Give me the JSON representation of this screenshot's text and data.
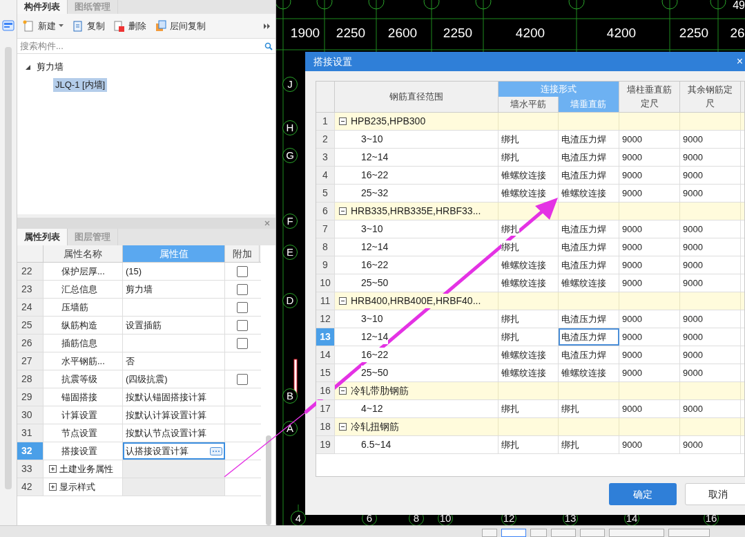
{
  "component_panel": {
    "tabs": [
      {
        "label": "构件列表",
        "selected": true
      },
      {
        "label": "图纸管理",
        "selected": false
      }
    ],
    "toolbar": [
      {
        "label": "新建",
        "dropdown": true
      },
      {
        "label": "复制",
        "dropdown": false
      },
      {
        "label": "删除",
        "dropdown": false
      },
      {
        "label": "层间复制",
        "dropdown": false
      }
    ],
    "search": {
      "placeholder": "搜索构件..."
    },
    "tree": [
      {
        "label": "剪力墙",
        "expanded": true,
        "selected": false,
        "children": [
          {
            "label": "JLQ-1 [内墙]",
            "selected": true
          }
        ]
      }
    ]
  },
  "property_panel": {
    "tabs": [
      {
        "label": "属性列表",
        "selected": true
      },
      {
        "label": "图层管理",
        "selected": false
      }
    ],
    "columns": [
      {
        "label": "属性名称",
        "selected": false
      },
      {
        "label": "属性值",
        "selected": true
      },
      {
        "label": "附加",
        "selected": false
      }
    ],
    "rows": [
      {
        "index": "22",
        "kind": "check",
        "name": "保护层厚...",
        "value": "(15)",
        "checked": false,
        "selected": false
      },
      {
        "index": "23",
        "kind": "check",
        "name": "汇总信息",
        "value": "剪力墙",
        "checked": false,
        "selected": false
      },
      {
        "index": "24",
        "kind": "check",
        "name": "压墙筋",
        "checked": false,
        "selected": false
      },
      {
        "index": "25",
        "kind": "check",
        "name": "纵筋构造",
        "value": "设置插筋",
        "checked": false,
        "selected": false
      },
      {
        "index": "26",
        "kind": "check",
        "name": "插筋信息",
        "checked": false,
        "selected": false
      },
      {
        "index": "27",
        "kind": "text",
        "name": "水平钢筋...",
        "value": "否",
        "selected": false
      },
      {
        "index": "28",
        "kind": "check",
        "name": "抗震等级",
        "value": "(四级抗震)",
        "checked": false,
        "selected": false
      },
      {
        "index": "29",
        "kind": "text",
        "name": "锚固搭接",
        "value": "按默认锚固搭接计算",
        "selected": false
      },
      {
        "index": "30",
        "kind": "text",
        "name": "计算设置",
        "value": "按默认计算设置计算",
        "selected": false
      },
      {
        "index": "31",
        "kind": "text",
        "name": "节点设置",
        "value": "按默认节点设置计算",
        "selected": false
      },
      {
        "index": "32",
        "kind": "edit",
        "name": "搭接设置",
        "value": "认搭接设置计算",
        "selected": true
      },
      {
        "index": "33",
        "kind": "group",
        "name": "土建业务属性",
        "expanded": false,
        "selected": false
      },
      {
        "index": "42",
        "kind": "group",
        "name": "显示样式",
        "expanded": false,
        "selected": false
      }
    ]
  },
  "canvas": {
    "top_dimensions": [
      "1900",
      "2250",
      "2600",
      "2250",
      "4200",
      "4200",
      "2250",
      "26"
    ],
    "corner_label": "49",
    "left_axes": [
      "J",
      "H",
      "G",
      "F",
      "E",
      "D",
      "B",
      "A"
    ],
    "bottom_axes": [
      "4",
      "6",
      "8",
      "10",
      "12",
      "13",
      "14",
      "16"
    ]
  },
  "dialog": {
    "title": "搭接设置",
    "close": "×",
    "header": {
      "range": "钢筋直径范围",
      "connection": {
        "label": "连接形式",
        "selected": true,
        "sub": [
          {
            "label": "墙水平筋",
            "selected": false
          },
          {
            "label": "墙垂直筋",
            "selected": true
          }
        ]
      },
      "wall_length": "墙柱垂直筋定尺",
      "other_length": "其余钢筋定尺"
    },
    "rows": [
      {
        "index": "1",
        "kind": "group",
        "label": "HPB235,HPB300",
        "expanded": true,
        "selected": false
      },
      {
        "index": "2",
        "kind": "item",
        "range": "3~10",
        "horizontal": "绑扎",
        "vertical": "电渣压力焊",
        "wall_length": "9000",
        "other_length": "9000",
        "selected": false
      },
      {
        "index": "3",
        "kind": "item",
        "range": "12~14",
        "horizontal": "绑扎",
        "vertical": "电渣压力焊",
        "wall_length": "9000",
        "other_length": "9000",
        "selected": false
      },
      {
        "index": "4",
        "kind": "item",
        "range": "16~22",
        "horizontal": "锥螺纹连接",
        "vertical": "电渣压力焊",
        "wall_length": "9000",
        "other_length": "9000",
        "selected": false
      },
      {
        "index": "5",
        "kind": "item",
        "range": "25~32",
        "horizontal": "锥螺纹连接",
        "vertical": "锥螺纹连接",
        "wall_length": "9000",
        "other_length": "9000",
        "selected": false
      },
      {
        "index": "6",
        "kind": "group",
        "label": "HRB335,HRB335E,HRBF33...",
        "expanded": true,
        "selected": false
      },
      {
        "index": "7",
        "kind": "item",
        "range": "3~10",
        "horizontal": "绑扎",
        "vertical": "电渣压力焊",
        "wall_length": "9000",
        "other_length": "9000",
        "selected": false
      },
      {
        "index": "8",
        "kind": "item",
        "range": "12~14",
        "horizontal": "绑扎",
        "vertical": "电渣压力焊",
        "wall_length": "9000",
        "other_length": "9000",
        "selected": false
      },
      {
        "index": "9",
        "kind": "item",
        "range": "16~22",
        "horizontal": "锥螺纹连接",
        "vertical": "电渣压力焊",
        "wall_length": "9000",
        "other_length": "9000",
        "selected": false
      },
      {
        "index": "10",
        "kind": "item",
        "range": "25~50",
        "horizontal": "锥螺纹连接",
        "vertical": "锥螺纹连接",
        "wall_length": "9000",
        "other_length": "9000",
        "selected": false
      },
      {
        "index": "11",
        "kind": "group",
        "label": "HRB400,HRB400E,HRBF40...",
        "expanded": true,
        "selected": false
      },
      {
        "index": "12",
        "kind": "item",
        "range": "3~10",
        "horizontal": "绑扎",
        "vertical": "电渣压力焊",
        "wall_length": "9000",
        "other_length": "9000",
        "selected": false
      },
      {
        "index": "13",
        "kind": "item",
        "range": "12~14",
        "horizontal": "绑扎",
        "vertical": "电渣压力焊",
        "wall_length": "9000",
        "other_length": "9000",
        "selected": true
      },
      {
        "index": "14",
        "kind": "item",
        "range": "16~22",
        "horizontal": "锥螺纹连接",
        "vertical": "电渣压力焊",
        "wall_length": "9000",
        "other_length": "9000",
        "selected": false
      },
      {
        "index": "15",
        "kind": "item",
        "range": "25~50",
        "horizontal": "锥螺纹连接",
        "vertical": "锥螺纹连接",
        "wall_length": "9000",
        "other_length": "9000",
        "selected": false
      },
      {
        "index": "16",
        "kind": "group",
        "label": "冷轧带肋钢筋",
        "expanded": true,
        "selected": false
      },
      {
        "index": "17",
        "kind": "item",
        "range": "4~12",
        "horizontal": "绑扎",
        "vertical": "绑扎",
        "wall_length": "9000",
        "other_length": "9000",
        "selected": false
      },
      {
        "index": "18",
        "kind": "group",
        "label": "冷轧扭钢筋",
        "expanded": true,
        "selected": false
      },
      {
        "index": "19",
        "kind": "item",
        "range": "6.5~14",
        "horizontal": "绑扎",
        "vertical": "绑扎",
        "wall_length": "9000",
        "other_length": "9000",
        "selected": false
      }
    ],
    "buttons": [
      {
        "label": "确定",
        "primary": true
      },
      {
        "label": "取消",
        "primary": false
      }
    ]
  }
}
